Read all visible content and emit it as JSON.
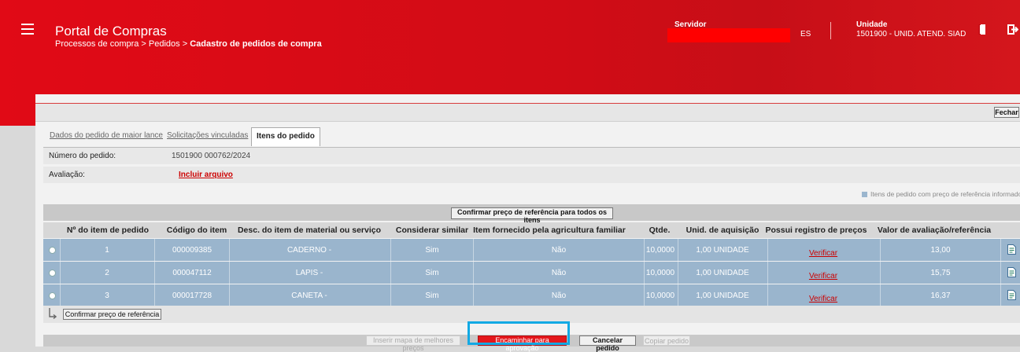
{
  "header": {
    "app_title": "Portal de Compras",
    "breadcrumb_prefix": "Processos de compra > Pedidos > ",
    "breadcrumb_current": "Cadastro de pedidos de compra",
    "servidor_label": "Servidor",
    "servidor_tail": "ES",
    "unidade_label": "Unidade",
    "unidade_value": "1501900 - UNID. ATEND. SIAD"
  },
  "toolbar": {
    "close_label": "Fechar"
  },
  "tabs": [
    {
      "label": "Dados do pedido de maior lance"
    },
    {
      "label": "Solicitações vinculadas"
    },
    {
      "label": "Itens do pedido"
    }
  ],
  "order": {
    "numero_label": "Número do pedido:",
    "numero_value": "1501900 000762/2024",
    "avaliacao_label": "Avaliação:",
    "avaliacao_link": "Incluir arquivo"
  },
  "legend": {
    "text": "Itens de pedido com preço de referência informado"
  },
  "confirm_all_label": "Confirmar preço de referência para todos os itens",
  "table": {
    "columns": [
      "Nº do item de pedido",
      "Código do item",
      "Desc. do item de material ou serviço",
      "Considerar similar",
      "Item fornecido pela agricultura familiar",
      "Qtde.",
      "Unid. de aquisição",
      "Possui registro de preços",
      "Valor de avaliação/referência"
    ],
    "rows": [
      {
        "num": "1",
        "codigo": "000009385",
        "desc": "CADERNO -",
        "similar": "Sim",
        "agricultura": "Não",
        "qtde": "10,0000",
        "unid": "1,00 UNIDADE",
        "registro": "Verificar",
        "valor": "13,00"
      },
      {
        "num": "2",
        "codigo": "000047112",
        "desc": "LAPIS -",
        "similar": "Sim",
        "agricultura": "Não",
        "qtde": "10,0000",
        "unid": "1,00 UNIDADE",
        "registro": "Verificar",
        "valor": "15,75"
      },
      {
        "num": "3",
        "codigo": "000017728",
        "desc": "CANETA -",
        "similar": "Sim",
        "agricultura": "Não",
        "qtde": "10,0000",
        "unid": "1,00 UNIDADE",
        "registro": "Verificar",
        "valor": "16,37"
      }
    ]
  },
  "confirm_selected_label": "Confirmar preço de referência",
  "actions": {
    "inserir_mapa": "Inserir mapa de melhores preços",
    "encaminhar": "Encaminhar para aprovação",
    "cancelar": "Cancelar pedido",
    "copiar": "Copiar pedido"
  },
  "colors": {
    "brand_red": "#e10a16",
    "row_blue": "#9ab5cd",
    "highlight": "#12a9e4"
  }
}
